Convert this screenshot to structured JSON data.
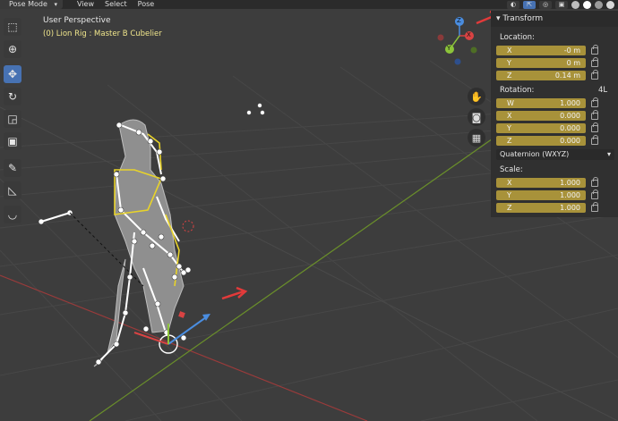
{
  "header": {
    "mode": "Pose Mode",
    "menu": [
      "View",
      "Select",
      "Pose"
    ]
  },
  "viewport": {
    "view_name": "User Perspective",
    "object_name": "(0) Lion Rig : Master B Cubelier"
  },
  "gizmo": {
    "x": "X",
    "y": "Y",
    "z": "Z"
  },
  "tools": [
    "select-box-icon",
    "cursor-icon",
    "move-icon",
    "rotate-icon",
    "scale-icon",
    "transform-icon",
    "annotate-icon",
    "measure-icon",
    "relax-pose-icon"
  ],
  "nav": [
    "hand-icon",
    "camera-icon",
    "grid-icon"
  ],
  "panel": {
    "title": "Transform",
    "location_label": "Location:",
    "location": [
      {
        "axis": "X",
        "value": "-0 m"
      },
      {
        "axis": "Y",
        "value": "0 m"
      },
      {
        "axis": "Z",
        "value": "0.14 m"
      }
    ],
    "rotation_label": "Rotation:",
    "rotation_mode_short": "4L",
    "rotation": [
      {
        "axis": "W",
        "value": "1.000"
      },
      {
        "axis": "X",
        "value": "0.000"
      },
      {
        "axis": "Y",
        "value": "0.000"
      },
      {
        "axis": "Z",
        "value": "0.000"
      }
    ],
    "rotation_mode": "Quaternion (WXYZ)",
    "scale_label": "Scale:",
    "scale": [
      {
        "axis": "X",
        "value": "1.000"
      },
      {
        "axis": "Y",
        "value": "1.000"
      },
      {
        "axis": "Z",
        "value": "1.000"
      }
    ]
  },
  "colors": {
    "x_axis": "#d94343",
    "y_axis": "#8cc43a",
    "z_axis": "#4a8de0",
    "field": "#a8923a",
    "active_tool": "#4772b3"
  }
}
